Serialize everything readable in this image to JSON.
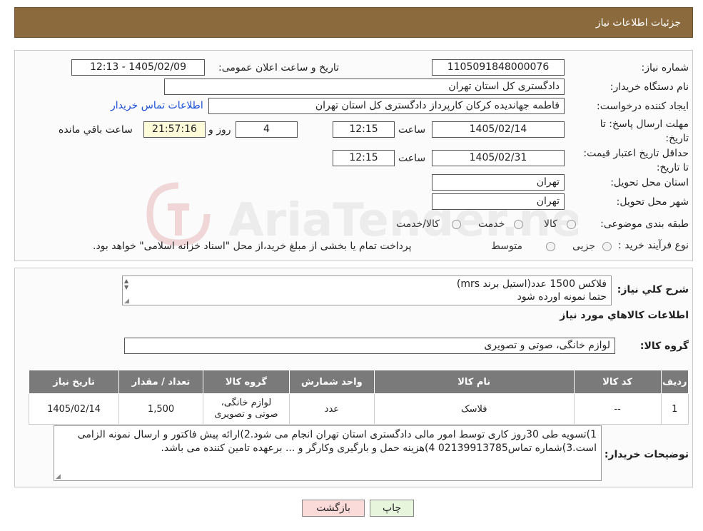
{
  "header": {
    "title": "جزئیات اطلاعات نیاز"
  },
  "fields": {
    "need_number_label": "شماره نیاز:",
    "need_number": "1105091848000076",
    "announce_label": "تاریخ و ساعت اعلان عمومی:",
    "announce_value": "1405/02/09 - 12:13",
    "buyer_org_label": "نام دستگاه خریدار:",
    "buyer_org": "دادگستری کل استان تهران",
    "creator_label": "ایجاد کننده درخواست:",
    "creator": "فاطمه جهاندیده کرکان کارپرداز دادگستری کل استان تهران",
    "contact_link": "اطلاعات تماس خریدار",
    "reply_deadline_label": "مهلت ارسال پاسخ: تا تاریخ:",
    "reply_date": "1405/02/14",
    "time_label": "ساعت",
    "reply_time": "12:15",
    "days_value": "4",
    "days_label": "روز و",
    "remaining_time": "21:57:16",
    "remaining_label": "ساعت باقي مانده",
    "price_valid_label": "حداقل تاریخ اعتبار قیمت: تا تاریخ:",
    "price_date": "1405/02/31",
    "price_time": "12:15",
    "province_label": "استان محل تحویل:",
    "province": "تهران",
    "city_label": "شهر محل تحویل:",
    "city": "تهران",
    "category_label": "طبقه بندی موضوعی:",
    "category_options": [
      "کالا",
      "خدمت",
      "کالا/خدمت"
    ],
    "process_label": "نوع فرآیند خرید :",
    "process_options": [
      "جزیی",
      "متوسط"
    ],
    "process_note": "پرداخت تمام یا بخشی از مبلغ خرید،از محل \"اسناد خزانه اسلامی\" خواهد بود."
  },
  "description": {
    "label": "شرح کلي نياز:",
    "line1": "فلاکس 1500 عدد(استیل برند mrs)",
    "line2": "حتما نمونه اورده شود"
  },
  "goods": {
    "section_title": "اطلاعات کالاهاي مورد نياز",
    "group_label": "گروه کالا:",
    "group_value": "لوازم خانگی، صوتی و تصویری",
    "table": {
      "headers": [
        "رديف",
        "کد کالا",
        "نام کالا",
        "واحد شمارش",
        "گروه کالا",
        "تعداد / مقدار",
        "تاريخ نياز"
      ],
      "rows": [
        [
          "1",
          "--",
          "فلاسک",
          "عدد",
          "لوازم خانگی، صوتی و تصویری",
          "1,500",
          "1405/02/14"
        ]
      ]
    }
  },
  "buyer_notes": {
    "label": "توضیحات خریدار:",
    "text": "1)تسویه طی 30روز کاری توسط امور مالی دادگستری استان تهران انجام می شود.2)ارائه پیش فاکتور و ارسال نمونه الزامی است.3)شماره تماس02139913785 4)هزینه حمل و بارگیری وکارگر و ... برعهده تامین کننده می باشد."
  },
  "buttons": {
    "print": "چاپ",
    "back": "بازگشت"
  },
  "colors": {
    "header_bg": "#8b6a3e",
    "table_header_bg": "#7a7a7a",
    "link": "#1a4fd6",
    "back_bg": "#fbdada",
    "print_bg": "#e6f5dc"
  }
}
